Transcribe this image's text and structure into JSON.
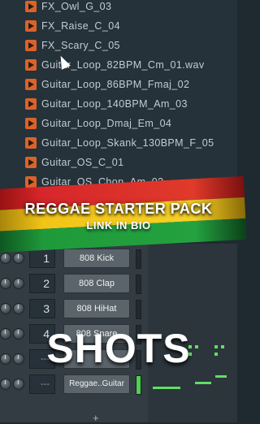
{
  "browser": {
    "files": [
      {
        "name": "FX_Owl_G_03"
      },
      {
        "name": "FX_Raise_C_04"
      },
      {
        "name": "FX_Scary_C_05"
      },
      {
        "name": "Guitar_Loop_82BPM_Cm_01.wav"
      },
      {
        "name": "Guitar_Loop_86BPM_Fmaj_02"
      },
      {
        "name": "Guitar_Loop_140BPM_Am_03"
      },
      {
        "name": "Guitar_Loop_Dmaj_Em_04"
      },
      {
        "name": "Guitar_Loop_Skank_130BPM_F_05"
      },
      {
        "name": "Guitar_OS_C_01"
      },
      {
        "name": "Guitar_OS_Chop_Am_02"
      }
    ]
  },
  "banner": {
    "title": "REGGAE STARTER PACK",
    "subtitle": "LINK IN BIO",
    "colors": {
      "red": "#d7262b",
      "yellow": "#f2c417",
      "green": "#1f9a3a"
    }
  },
  "channel_rack": {
    "rows": [
      {
        "number": "1",
        "name": "808 Kick"
      },
      {
        "number": "2",
        "name": "808 Clap"
      },
      {
        "number": "3",
        "name": "808 HiHat"
      },
      {
        "number": "4",
        "name": "808 Snare"
      },
      {
        "number": "---",
        "name": ""
      },
      {
        "number": "---",
        "name": "Reggae..Guitar"
      }
    ],
    "add_label": "+"
  },
  "overlay": {
    "caption": "SHOTS"
  }
}
